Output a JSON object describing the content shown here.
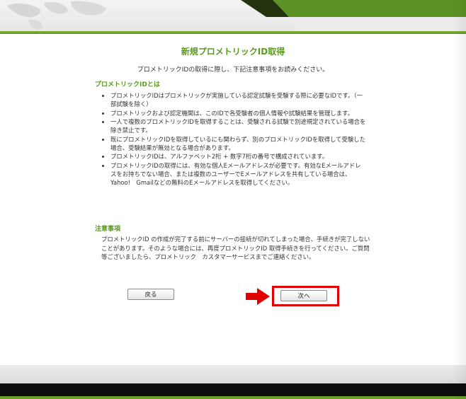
{
  "header": {
    "brand_color": "#6aa02a",
    "dark_band_color": "#2c3a12"
  },
  "main": {
    "title": "新規プロメトリックID取得",
    "intro": "プロメトリックIDの取得に際し、下記注意事項をお読みください。",
    "section1": {
      "heading": "プロメトリックIDとは",
      "bullets": [
        "プロメトリックIDはプロメトリックが実施している認定試験を受験する際に必要なIDです。（一部試験を除く）",
        "プロメトリックおよび認定機関は、このIDで各受験者の個人情報や試験結果を管理します。",
        "一人で複数のプロメトリックIDを取得することは、受験される試験で別途規定されている場合を除き禁止です。",
        "既にプロメトリックIDを取得しているにも関わらず、別のプロメトリックIDを取得して受験した場合、受験結果が無効となる場合があります。",
        "プロメトリックIDは、アルファベット2桁 + 数字7桁の番号で構成されています。",
        "プロメトリックIDの取得には、有効な個人Eメールアドレスが必要です。有効なEメールアドレスをお持ちでない場合、または複数のユーザーでEメールアドレスを共有している場合は、Yahoo!　Gmailなどの無料のEメールアドレスを取得してください。"
      ]
    },
    "section2": {
      "heading": "注意事項",
      "text": "プロメトリックID の作成が完了する前にサーバーの接続が切れてしまった場合、手続きが完了しないことがあります。そのような場合には、再度プロメトリックID 取得手続きを行ってください。ご質問等ございましたら、プロメトリック　カスタマーサービスまでご連絡ください。"
    },
    "buttons": {
      "back_label": "戻る",
      "next_label": "次へ"
    },
    "highlight_color": "#e00000"
  }
}
